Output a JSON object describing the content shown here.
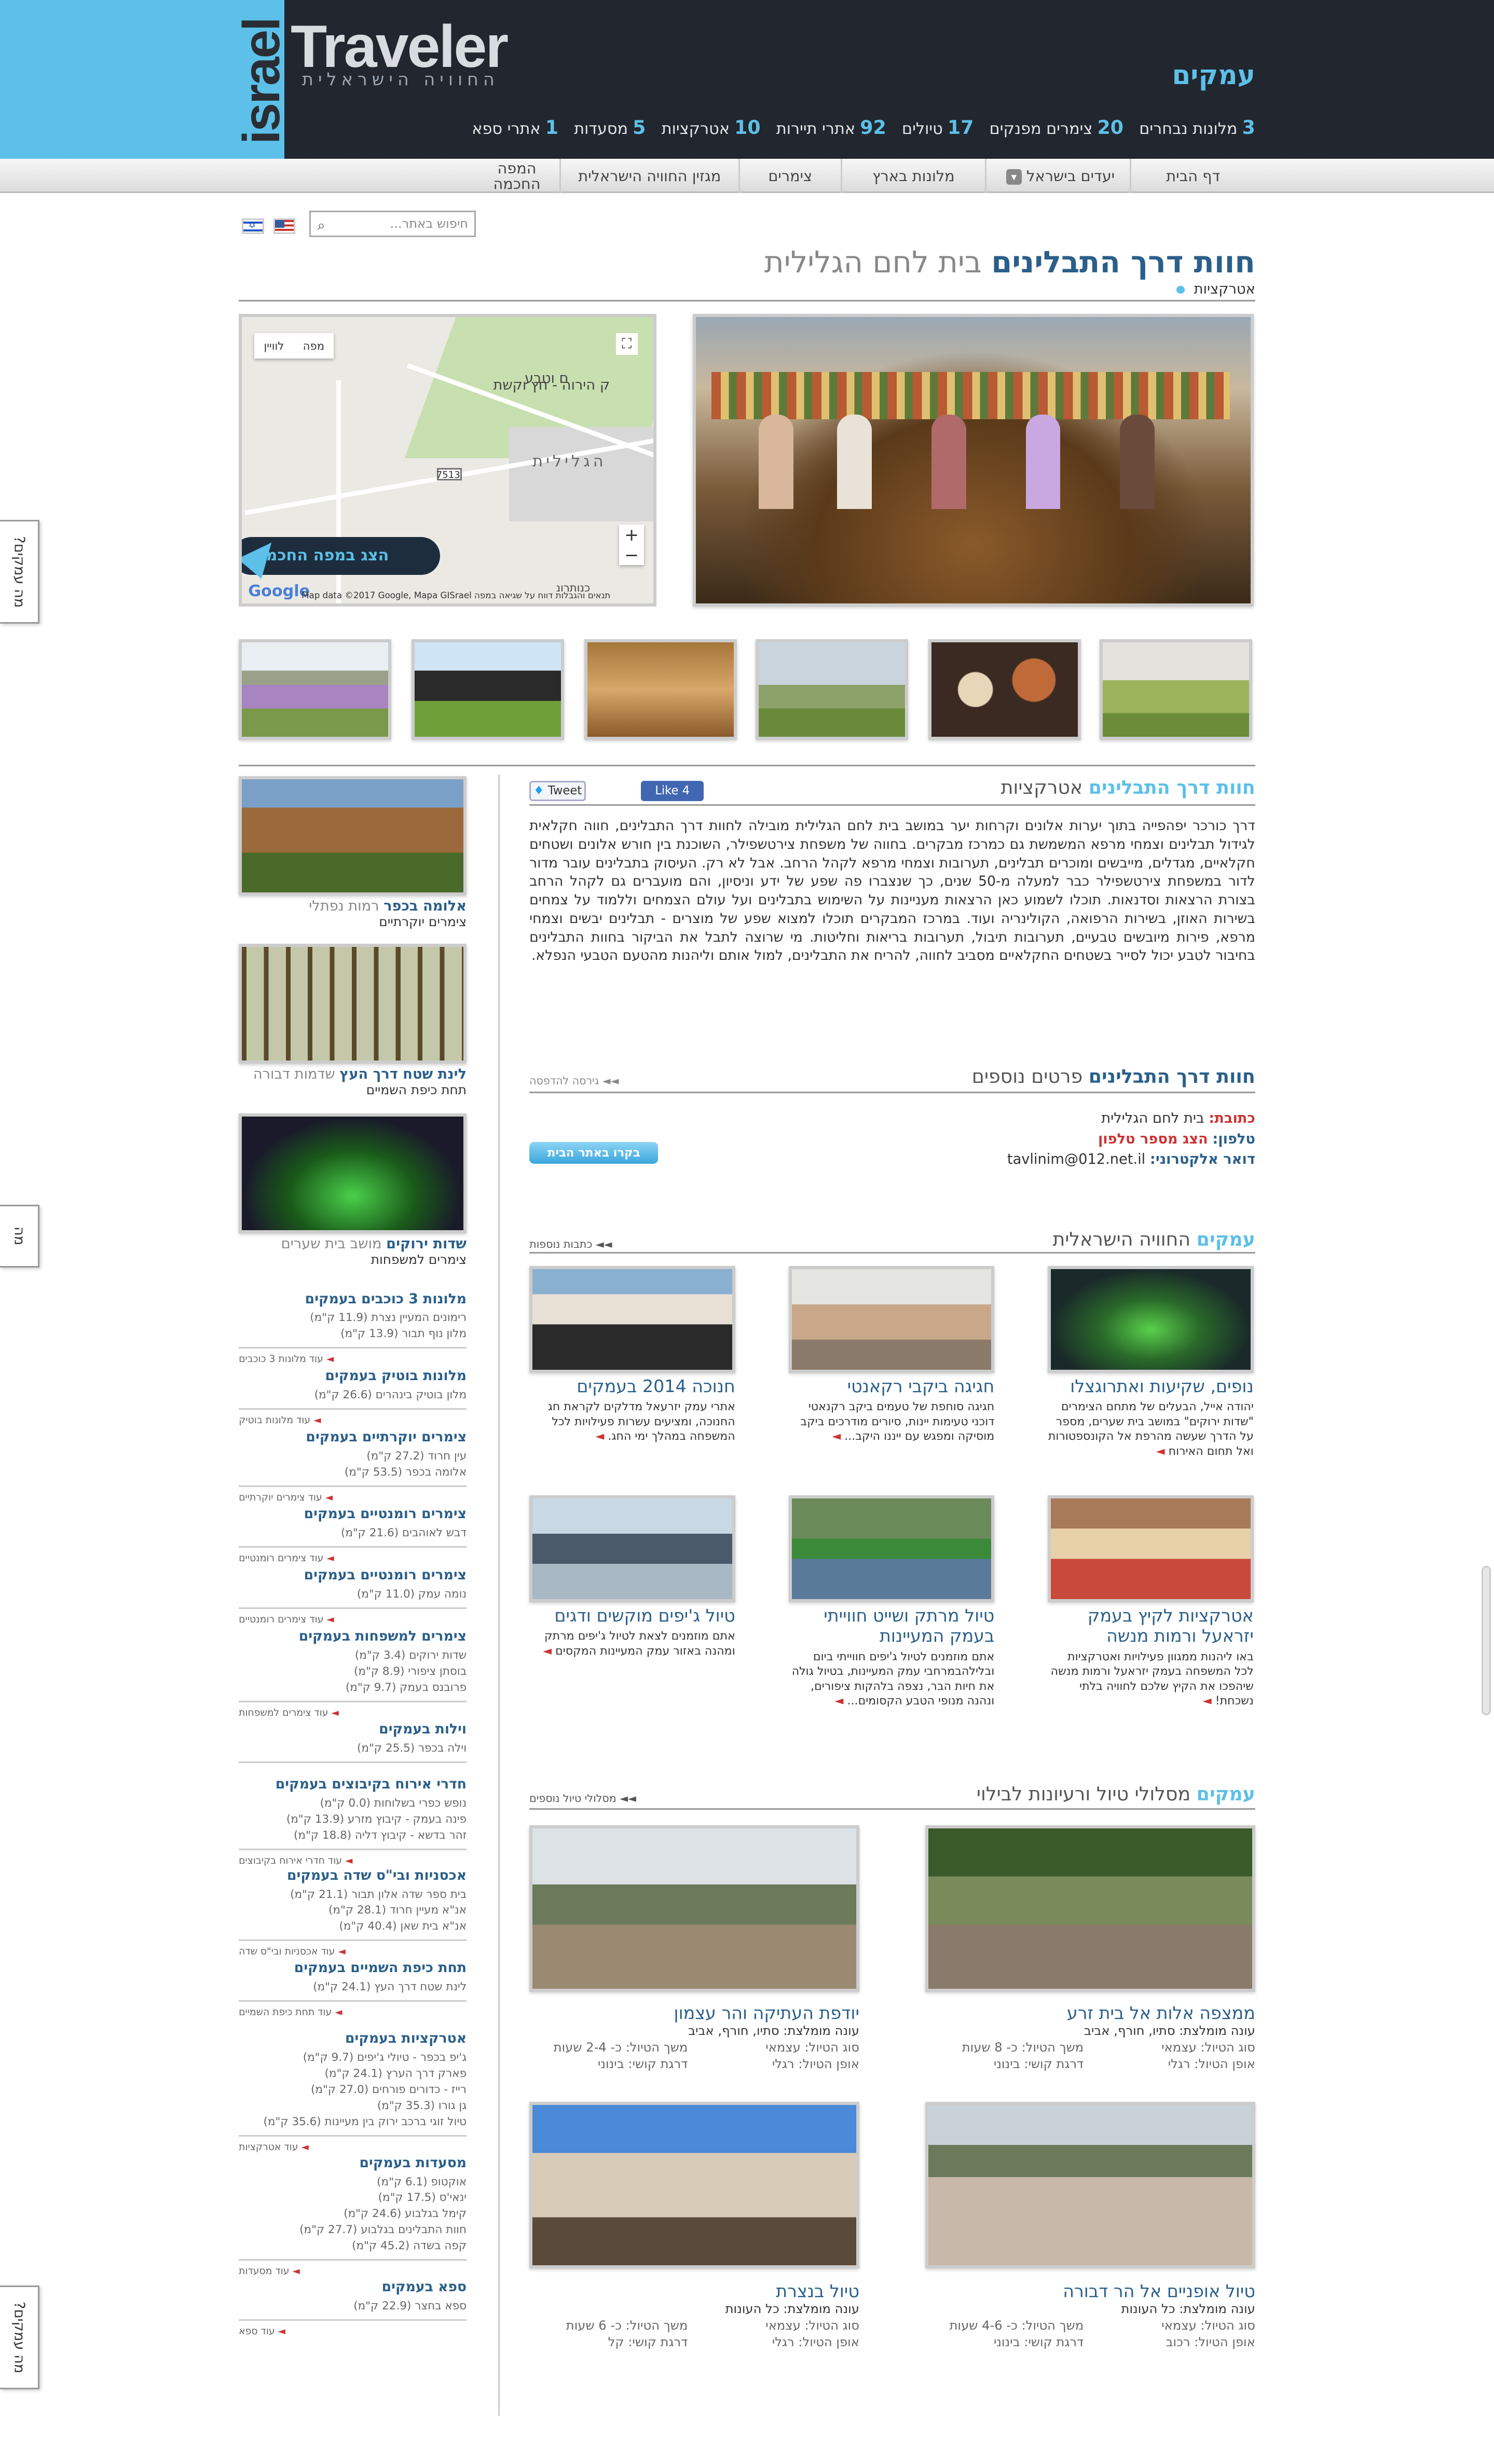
{
  "header": {
    "logo_israel": "israel",
    "logo_traveler": "Traveler",
    "logo_tagline": "החוויה הישראלית",
    "region": "עמקים",
    "stats": [
      {
        "n": "3",
        "l": "מלונות נבחרים"
      },
      {
        "n": "20",
        "l": "צימרים מפנקים"
      },
      {
        "n": "17",
        "l": "טיולים"
      },
      {
        "n": "92",
        "l": "אתרי תיירות"
      },
      {
        "n": "10",
        "l": "אטרקציות"
      },
      {
        "n": "5",
        "l": "מסעדות"
      },
      {
        "n": "1",
        "l": "אתרי ספא"
      }
    ]
  },
  "nav": {
    "items": [
      "דף הבית",
      "יעדים בישראל",
      "מלונות בארץ",
      "צימרים",
      "מגזין החוויה הישראלית",
      "המפה",
      "החכמה"
    ]
  },
  "search": {
    "placeholder": "חיפוש באתר..."
  },
  "page": {
    "title_main": "חוות דרך התבלינים",
    "title_place": "בית לחם הגלילית",
    "crumb": "אטרקציות"
  },
  "map": {
    "btn_map": "מפה",
    "btn_sat": "לוויין",
    "fullscreen": "⛶",
    "zoom_in": "+",
    "zoom_out": "−",
    "cta": "הצג במפה החכמה",
    "google": "Google",
    "copyright": "Map data ©2017 Google, Mapa GISrael   תנאים והגבלות   דווח על שגיאה במפה",
    "lbl1": "הגלילית",
    "lbl2": "ק הירוה - חץ וקשת",
    "lbl3": "ם וטבע",
    "lbl4": "כנותרונ",
    "badge": "7513"
  },
  "sidebar": {
    "featured": [
      {
        "name": "אלומה בכפר",
        "place": "רמות נפתלי",
        "type": "צימרים יוקרתיים"
      },
      {
        "name": "לינת שטח דרך העץ",
        "place": "שדמות דבורה",
        "type": "תחת כיפת השמיים"
      },
      {
        "name": "שדות ירוקים",
        "place": "מושב בית שערים",
        "type": "צימרים למשפחות"
      }
    ],
    "cats": [
      {
        "h": "מלונות 3 כוכבים בעמקים",
        "items": [
          "רימונים המעיין נצרת (11.9 ק\"מ)",
          "מלון נוף תבור (13.9 ק\"מ)"
        ],
        "more": "עוד מלונות 3 כוכבים"
      },
      {
        "h": "מלונות בוטיק בעמקים",
        "items": [
          "מלון בוטיק בינהרים (26.6 ק\"מ)"
        ],
        "more": "עוד מלונות בוטיק"
      },
      {
        "h": "צימרים יוקרתיים בעמקים",
        "items": [
          "עין חרוד (27.2 ק\"מ)",
          "אלומה בכפר (53.5 ק\"מ)"
        ],
        "more": "עוד צימרים יוקרתיים"
      },
      {
        "h": "צימרים רומנטיים בעמקים",
        "items": [
          "דבש לאוהבים (21.6 ק\"מ)"
        ],
        "more": "עוד צימרים רומנטיים"
      },
      {
        "h": "צימרים רומנטיים בעמקים",
        "items": [
          "נומה עמק (11.0 ק\"מ)"
        ],
        "more": "עוד צימרים רומנטיים"
      },
      {
        "h": "צימרים למשפחות בעמקים",
        "items": [
          "שדות ירוקים (3.4 ק\"מ)",
          "בוסתן ציפורי (8.9 ק\"מ)",
          "פרובנס בעמק (9.7 ק\"מ)"
        ],
        "more": "עוד צימרים למשפחות"
      },
      {
        "h": "וילות בעמקים",
        "items": [
          "וילה בכפר (25.5 ק\"מ)"
        ],
        "more": ""
      },
      {
        "h": "חדרי אירוח בקיבוצים בעמקים",
        "items": [
          "נופש כפרי בשלוחות (0.0 ק\"מ)",
          "פינה בעמק - קיבוץ מזרע (13.9 ק\"מ)",
          "זהר בדשא - קיבוץ דליה (18.8 ק\"מ)"
        ],
        "more": "עוד חדרי אירוח בקיבוצים"
      },
      {
        "h": "אכסניות ובי\"ס שדה בעמקים",
        "items": [
          "בית ספר שדה אלון תבור (21.1 ק\"מ)",
          "אנ\"א מעיין חרוד (28.1 ק\"מ)",
          "אנ\"א בית שאן (40.4 ק\"מ)"
        ],
        "more": "עוד אכסניות ובי\"ס שדה"
      },
      {
        "h": "תחת כיפת השמיים בעמקים",
        "items": [
          "לינת שטח דרך העץ (24.1 ק\"מ)"
        ],
        "more": "עוד תחת כיפת השמיים"
      },
      {
        "h": "אטרקציות בעמקים",
        "items": [
          "ג'יפ בכפר - טיולי ג'יפים (9.7 ק\"מ)",
          "פארק דרך הערץ (24.1 ק\"מ)",
          "רייז - כדורים פורחים (27.0 ק\"מ)",
          "גן גורו (35.3 ק\"מ)",
          "טיול זוגי ברכב ירוק בין מעיינות (35.6 ק\"מ)"
        ],
        "more": "עוד אטרקציות"
      },
      {
        "h": "מסעדות בעמקים",
        "items": [
          "אוקטופ (6.1 ק\"מ)",
          "ינאי'ס (17.5 ק\"מ)",
          "קימל בגלבוע (24.6 ק\"מ)",
          "חוות התבלינים בגלבוע (27.7 ק\"מ)",
          "קפה בשדה (45.2 ק\"מ)"
        ],
        "more": "עוד מסעדות"
      },
      {
        "h": "ספא בעמקים",
        "items": [
          "ספא בחצר (22.9 ק\"מ)"
        ],
        "more": "עוד ספא"
      }
    ]
  },
  "main": {
    "sec1_a": "חוות דרך התבלינים",
    "sec1_b": "אטרקציות",
    "tweet": "Tweet",
    "like": "Like 4",
    "body": "דרך כורכר יפהפייה בתוך יערות אלונים וקרחות יער במושב בית לחם הגלילית מובילה לחוות דרך התבלינים, חווה חקלאית לגידול תבלינים וצמחי מרפא המשמשת גם כמרכז מבקרים. בחווה של משפחת צירטשפילר, השוכנת בין חורש אלונים ושטחים חקלאיים, מגדלים, מייבשים ומוכרים תבלינים, תערובות וצמחי מרפא לקהל הרחב. אבל לא רק. העיסוק בתבלינים עובר מדור לדור במשפחת צירטשפילר כבר למעלה מ-50 שנים, כך שנצברו פה שפע של ידע וניסיון, והם מועברים גם לקהל הרחב בצורת הרצאות וסדנאות. תוכלו לשמוע כאן הרצאות מעניינות על השימוש בתבלינים ועל עולם הצמחים וללמוד על צמחים בשירות האוזן, בשירות הרפואה, הקולינריה ועוד. במרכז המבקרים תוכלו למצוא שפע של מוצרים - תבלינים יבשים וצמחי מרפא, פירות מיובשים טבעיים, תערובות תיבול, תערובות בריאות וחליטות. מי שרוצה לתבל את הביקור בחוות התבלינים בחיבור לטבע יכול לסייר בשטחים החקלאיים מסביב לחווה, להריח את התבלינים, למול אותם וליהנות מהטעם הטבעי הנפלא.",
    "sec2_a": "חוות דרך התבלינים",
    "sec2_b": "פרטים נוספים",
    "print": "גירסה להדפסה",
    "addr_k": "כתובת:",
    "addr_v": "בית לחם הגלילית",
    "phone_k": "טלפון:",
    "phone_v": "הצג מספר טלפון",
    "email_k": "דואר אלקטרוני:",
    "email_v": "tavlinim@012.net.il",
    "visit": "בקרו באתר הבית",
    "sec3_a": "עמקים",
    "sec3_b": "החוויה הישראלית",
    "more_articles": "כתבות נוספות",
    "articles": [
      {
        "t": "נופים, שקיעות ואתרוגצלו",
        "d": "יהודה אייל, הבעלים של מתחם הצימרים \"שדות ירוקים\" במושב בית שערים, מספר על הדרך שעשה מהרפת אל הקונספטורות ואל תחום האירוח"
      },
      {
        "t": "חגיגה ביקבי רקאנטי",
        "d": "חגיגה סוחפת של טעמים ביקב רקנאטי דוכני טעימות יינות, סיורים מודרכים ביקב מוסיקה ומפגש עם ייננו היקב..."
      },
      {
        "t": "חנוכה 2014 בעמקים",
        "d": "אתרי עמק יזרעאל מדלקים לקראת חג החנוכה, ומציעים עשרות פעילויות לכל המשפחה במהלך ימי החג."
      },
      {
        "t": "אטרקציות לקיץ בעמק יזראעל ורמות מנשה",
        "d": "באו ליהנות ממגוון פעילויות ואטרקציות לכל המשפחה בעמק יזראעל ורמות מנשה שיהפכו את הקיץ שלכם לחוויה בלתי נשכחת!"
      },
      {
        "t": "טיול מרתק ושייט חווייתי בעמק המעיינות",
        "d": "אתם מוזמנים לטיול ג'יפים חווייתי ביום ובלילהבמרחבי עמק המעיינות, בטיול גולה את חיות הבר, נצפה בלהקות ציפורים, ונהנה מנופי הטבע הקסומים..."
      },
      {
        "t": "טיול ג'יפים מוקשים ודגים",
        "d": "אתם מוזמנים לצאת לטיול ג'יפים מרתק ומהנה באזור עמק המעיינות המקסים"
      }
    ],
    "sec4_a": "עמקים",
    "sec4_b": "מסלולי טיול ורעיונות לבילוי",
    "more_routes": "מסלולי טיול נוספים",
    "routes": [
      {
        "t": "ממצפה אלות אל בית זרע",
        "season": "עונה מומלצת: סתיו, חורף, אביב",
        "type": "סוג הטיול: עצמאי",
        "mode": "אופן הטיול: רגלי",
        "dur": "משך הטיול: כ- 8 שעות",
        "diff": "דרגת קושי: בינוני"
      },
      {
        "t": "יודפת העתיקה והר עצמון",
        "season": "עונה מומלצת: סתיו, חורף, אביב",
        "type": "סוג הטיול: עצמאי",
        "mode": "אופן הטיול: רגלי",
        "dur": "משך הטיול: כ- 2-4 שעות",
        "diff": "דרגת קושי: בינוני"
      },
      {
        "t": "טיול אופניים אל הר דבורה",
        "season": "עונה מומלצת: כל העונות",
        "type": "סוג הטיול: עצמאי",
        "mode": "אופן הטיול: רכוב",
        "dur": "משך הטיול: כ- 4-6 שעות",
        "diff": "דרגת קושי: בינוני"
      },
      {
        "t": "טיול בנצרת",
        "season": "עונה מומלצת: כל העונות",
        "type": "סוג הטיול: עצמאי",
        "mode": "אופן הטיול: רגלי",
        "dur": "משך הטיול: כ- 6 שעות",
        "diff": "דרגת קושי: קל"
      }
    ]
  },
  "sidetab": {
    "label": "מה עמקים?"
  }
}
